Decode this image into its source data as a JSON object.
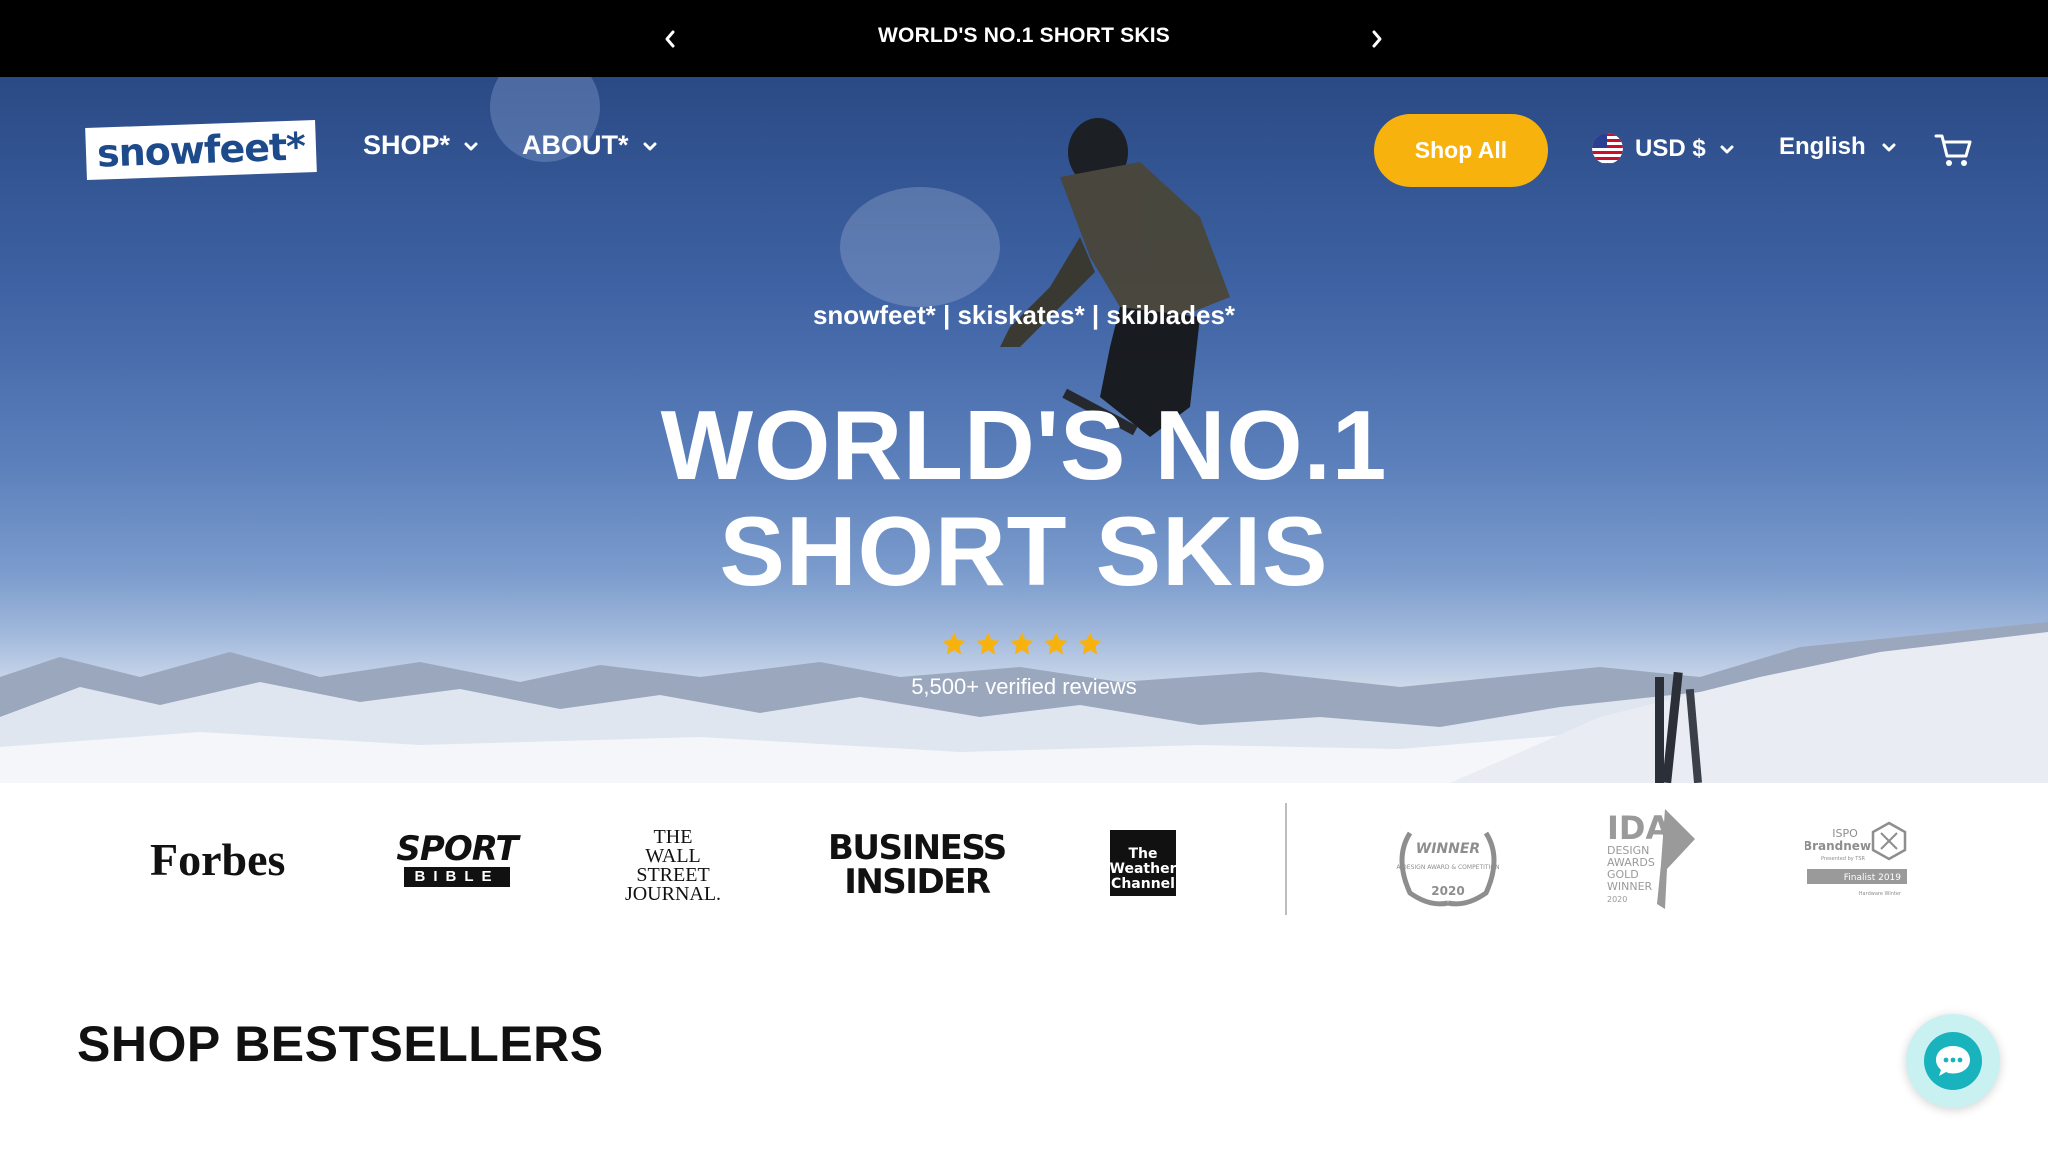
{
  "announcement": {
    "text": "WORLD'S NO.1 SHORT SKIS",
    "prev_icon": "chevron-left-icon",
    "next_icon": "chevron-right-icon"
  },
  "header": {
    "logo_text": "snowfeet*",
    "nav": [
      {
        "label": "SHOP*",
        "icon": "chevron-down-icon"
      },
      {
        "label": "ABOUT*",
        "icon": "chevron-down-icon"
      }
    ],
    "shop_all_label": "Shop All",
    "currency": {
      "label": "USD $",
      "icon": "us-flag-icon"
    },
    "language": {
      "label": "English"
    },
    "cart_icon": "cart-icon"
  },
  "hero": {
    "subtitle": "snowfeet* | skiskates* | skiblades*",
    "title_line1": "WORLD'S NO.1",
    "title_line2": "SHORT SKIS",
    "rating": 5,
    "rating_max": 5,
    "reviews": "5,500+ verified reviews"
  },
  "press": {
    "forbes": "Forbes",
    "sportbible_1": "SPORT",
    "sportbible_2": "BIBLE",
    "wsj_1": "THE",
    "wsj_2": "WALL STREET",
    "wsj_3": "JOURNAL.",
    "bi_1": "BUSINESS",
    "bi_2": "INSIDER",
    "twc_1": "The",
    "twc_2": "Weather",
    "twc_3": "Channel",
    "award1_title": "WINNER",
    "award1_sub": "A'DESIGN AWARD & COMPETITION",
    "award1_year": "2020",
    "award2_1": "IDA",
    "award2_2": "DESIGN",
    "award2_3": "AWARDS",
    "award2_4": "GOLD",
    "award2_5": "WINNER",
    "award2_6": "2020",
    "award3_1": "ISPO",
    "award3_2": "Brandnew",
    "award3_3": "Presented by TSR",
    "award3_4": "Finalist 2019",
    "award3_5": "Hardware Winter"
  },
  "section_title": "SHOP BESTSELLERS",
  "colors": {
    "accent": "#f8b20d",
    "announcement_bg": "#000000",
    "logo_text": "#1d4a8a",
    "chat": "#18b3bd"
  }
}
